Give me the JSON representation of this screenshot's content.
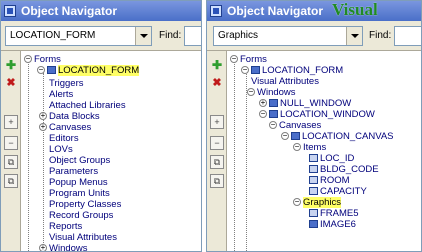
{
  "left_panel": {
    "title": "Object Navigator",
    "combo_value": "LOCATION_FORM",
    "find_label": "Find:",
    "toolbar_icons": [
      "add-icon",
      "delete-icon",
      "expand-icon",
      "collapse-icon",
      "expand-all-icon",
      "collapse-all-icon"
    ],
    "tree": {
      "root": "Forms",
      "form": "LOCATION_FORM",
      "children": [
        "Triggers",
        "Alerts",
        "Attached Libraries",
        "Data Blocks",
        "Canvases",
        "Editors",
        "LOVs",
        "Object Groups",
        "Parameters",
        "Popup Menus",
        "Program Units",
        "Property Classes",
        "Record Groups",
        "Reports",
        "Visual Attributes",
        "Windows"
      ]
    }
  },
  "right_panel": {
    "title": "Object Navigator",
    "overlay_caption": "Visual",
    "combo_value": "Graphics",
    "find_label": "Find:",
    "tree": {
      "root": "Forms",
      "form": "LOCATION_FORM",
      "visual_attributes": "Visual Attributes",
      "windows": "Windows",
      "null_window": "NULL_WINDOW",
      "location_window": "LOCATION_WINDOW",
      "canvases": "Canvases",
      "location_canvas": "LOCATION_CANVAS",
      "items": "Items",
      "item_list": [
        "LOC_ID",
        "BLDG_CODE",
        "ROOM",
        "CAPACITY"
      ],
      "graphics": "Graphics",
      "graphics_list": [
        "FRAME5",
        "IMAGE6"
      ]
    }
  }
}
